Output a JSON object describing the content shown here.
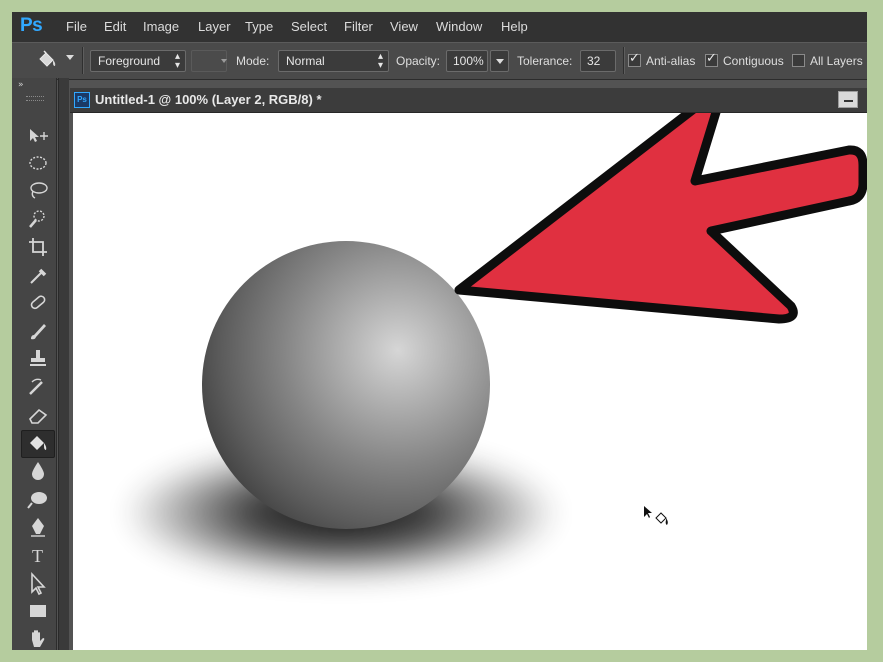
{
  "app": {
    "logo": "Ps"
  },
  "menu": [
    "File",
    "Edit",
    "Image",
    "Layer",
    "Type",
    "Select",
    "Filter",
    "View",
    "Window",
    "Help"
  ],
  "options": {
    "preset": "Foreground",
    "mode_label": "Mode:",
    "mode_value": "Normal",
    "opacity_label": "Opacity:",
    "opacity_value": "100%",
    "tolerance_label": "Tolerance:",
    "tolerance_value": "32",
    "anti_alias": {
      "label": "Anti-alias",
      "checked": true
    },
    "contiguous": {
      "label": "Contiguous",
      "checked": true
    },
    "all_layers": {
      "label": "All Layers",
      "checked": false
    }
  },
  "document": {
    "icon_text": "Ps",
    "title": "Untitled-1 @ 100% (Layer 2, RGB/8) *",
    "minimize_glyph": "—"
  },
  "annotation": {
    "arrow_color": "#e03040"
  },
  "tools": [
    "move-icon",
    "marquee-icon",
    "lasso-icon",
    "quick-select-icon",
    "crop-icon",
    "eyedropper-icon",
    "healing-icon",
    "brush-icon",
    "stamp-icon",
    "history-brush-icon",
    "eraser-icon",
    "paint-bucket-icon",
    "blur-icon",
    "dodge-icon",
    "pen-icon",
    "type-icon",
    "path-select-icon",
    "rectangle-icon",
    "hand-icon"
  ]
}
